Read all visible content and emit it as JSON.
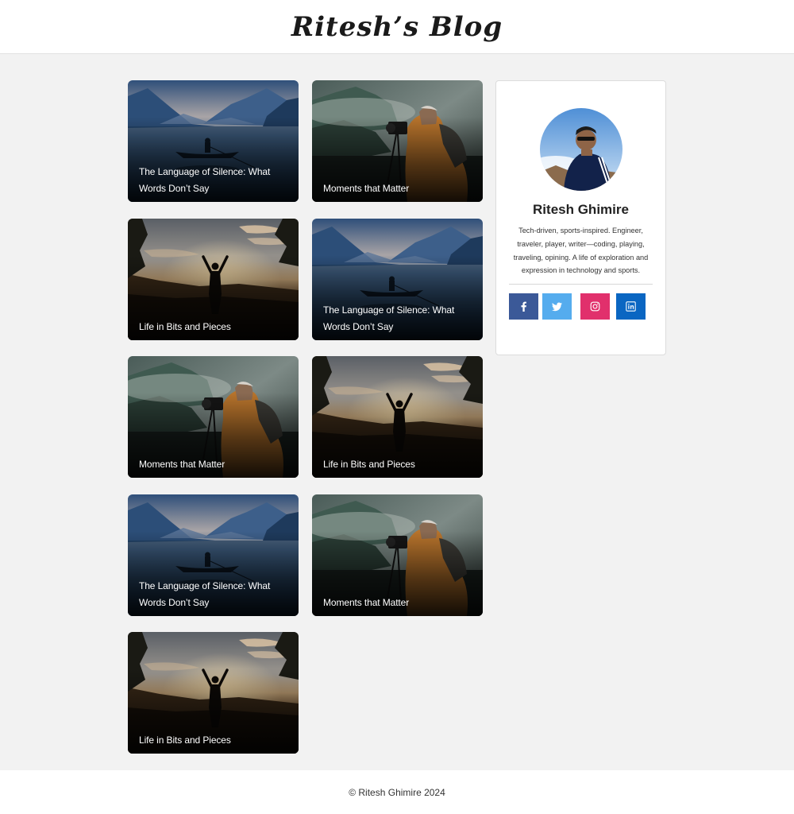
{
  "header": {
    "title": "Ritesh’s Blog"
  },
  "posts": [
    {
      "title": "The Language of Silence: What Words Don’t Say",
      "scene": "lake-boat"
    },
    {
      "title": "Moments that Matter",
      "scene": "photographer"
    },
    {
      "title": "Life in Bits and Pieces",
      "scene": "sunset-silhouette"
    },
    {
      "title": "The Language of Silence: What Words Don’t Say",
      "scene": "lake-boat"
    },
    {
      "title": "Moments that Matter",
      "scene": "photographer"
    },
    {
      "title": "Life in Bits and Pieces",
      "scene": "sunset-silhouette"
    },
    {
      "title": "The Language of Silence: What Words Don’t Say",
      "scene": "lake-boat"
    },
    {
      "title": "Moments that Matter",
      "scene": "photographer"
    },
    {
      "title": "Life in Bits and Pieces",
      "scene": "sunset-silhouette"
    }
  ],
  "profile": {
    "name": "Ritesh Ghimire",
    "bio": "Tech-driven, sports-inspired. Engineer, traveler, player, writer—coding, playing, traveling, opining. A life of exploration and expression in technology and sports.",
    "social": [
      {
        "icon": "facebook-icon",
        "color": "#3b5998"
      },
      {
        "icon": "twitter-icon",
        "color": "#55acee"
      },
      {
        "icon": "instagram-icon",
        "color": "#e1306c"
      },
      {
        "icon": "linkedin-icon",
        "color": "#0a66c2"
      }
    ]
  },
  "footer": {
    "text": "© Ritesh Ghimire 2024"
  }
}
